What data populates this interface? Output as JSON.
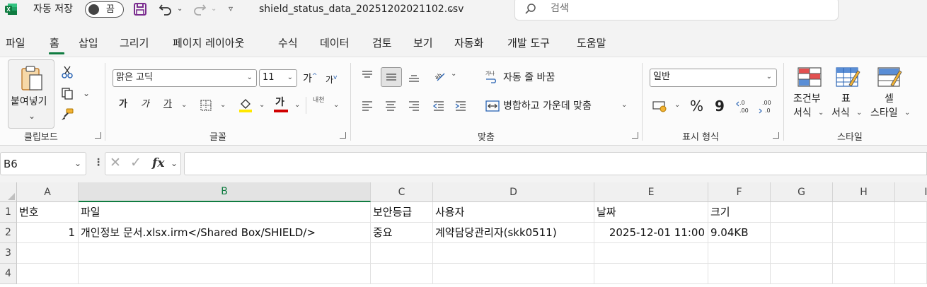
{
  "titlebar": {
    "autosave_label": "자동 저장",
    "autosave_state": "끔",
    "filename": "shield_status_data_20251202021102.csv",
    "search_placeholder": "검색"
  },
  "menu": {
    "tabs": [
      "파일",
      "홈",
      "삽입",
      "그리기",
      "페이지 레이아웃",
      "수식",
      "데이터",
      "검토",
      "보기",
      "자동화",
      "개발 도구",
      "도움말"
    ],
    "active": "홈"
  },
  "ribbon": {
    "clipboard": {
      "paste_label": "붙여넣기",
      "group_label": "클립보드"
    },
    "font": {
      "name": "맑은 고딕",
      "size": "11",
      "bold": "가",
      "italic": "가",
      "underline": "가",
      "font_color": "가",
      "phonetic": "내천",
      "group_label": "글꼴"
    },
    "alignment": {
      "wrap_text": "자동 줄 바꿈",
      "merge_center": "병합하고 가운데 맞춤",
      "group_label": "맞춤"
    },
    "number": {
      "format": "일반",
      "percent": "%",
      "comma": "9",
      "group_label": "표시 형식"
    },
    "styles": {
      "conditional_1": "조건부",
      "conditional_2": "서식",
      "table_1": "표",
      "table_2": "서식",
      "cell_1": "셀",
      "cell_2": "스타일",
      "group_label": "스타일"
    }
  },
  "formula_bar": {
    "name_box": "B6",
    "fx": "fx",
    "formula": ""
  },
  "sheet": {
    "columns": [
      "A",
      "B",
      "C",
      "D",
      "E",
      "F",
      "G",
      "H",
      "I"
    ],
    "rows": [
      "1",
      "2",
      "3",
      "4"
    ],
    "header_row": [
      "번호",
      "파일",
      "보안등급",
      "사용자",
      "날짜",
      "크기"
    ],
    "data_row": [
      "1",
      "개인정보 문서.xlsx.irm</Shared Box/SHIELD/>",
      "중요",
      "계약담당관리자(skk0511)",
      "2025-12-01 11:00",
      "9.04KB"
    ]
  },
  "colors": {
    "excel_green": "#107c41",
    "font_red": "#d00000",
    "highlight_yellow": "#ffe800",
    "save_purple": "#7b2c8f"
  }
}
